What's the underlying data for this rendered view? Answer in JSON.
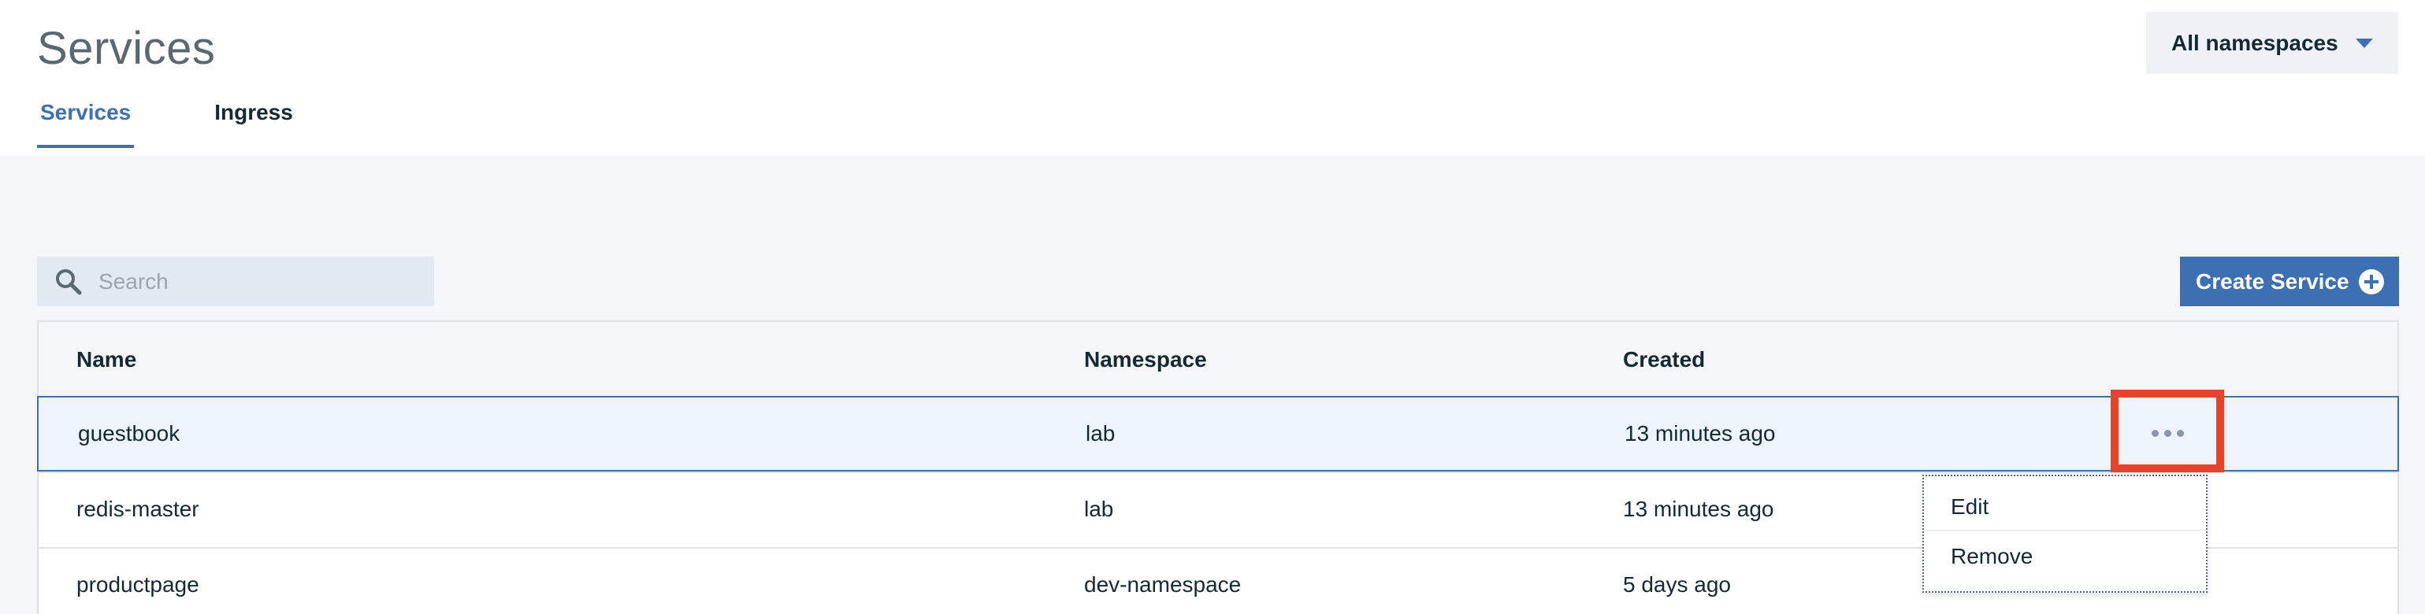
{
  "page": {
    "title": "Services"
  },
  "tabs": [
    {
      "label": "Services",
      "active": true
    },
    {
      "label": "Ingress",
      "active": false
    }
  ],
  "namespace_select": {
    "selected": "All namespaces"
  },
  "search": {
    "placeholder": "Search",
    "value": ""
  },
  "create_button": {
    "label": "Create Service"
  },
  "table": {
    "columns": [
      "Name",
      "Namespace",
      "Created"
    ],
    "rows": [
      {
        "name": "guestbook",
        "namespace": "lab",
        "created": "13 minutes ago",
        "selected": true
      },
      {
        "name": "redis-master",
        "namespace": "lab",
        "created": "13 minutes ago",
        "selected": false
      },
      {
        "name": "productpage",
        "namespace": "dev-namespace",
        "created": "5 days ago",
        "selected": false
      }
    ]
  },
  "overflow_menu": {
    "items": [
      "Edit",
      "Remove"
    ]
  },
  "colors": {
    "accent": "#3d70b2",
    "highlight_box": "#e8432a",
    "content_bg": "#f4f6f9",
    "selected_row_bg": "#edf4fc"
  },
  "icons": {
    "search": "search-icon",
    "namespace_caret": "caret-down-icon",
    "create": "plus-circle-icon",
    "overflow": "overflow-menu-icon"
  }
}
